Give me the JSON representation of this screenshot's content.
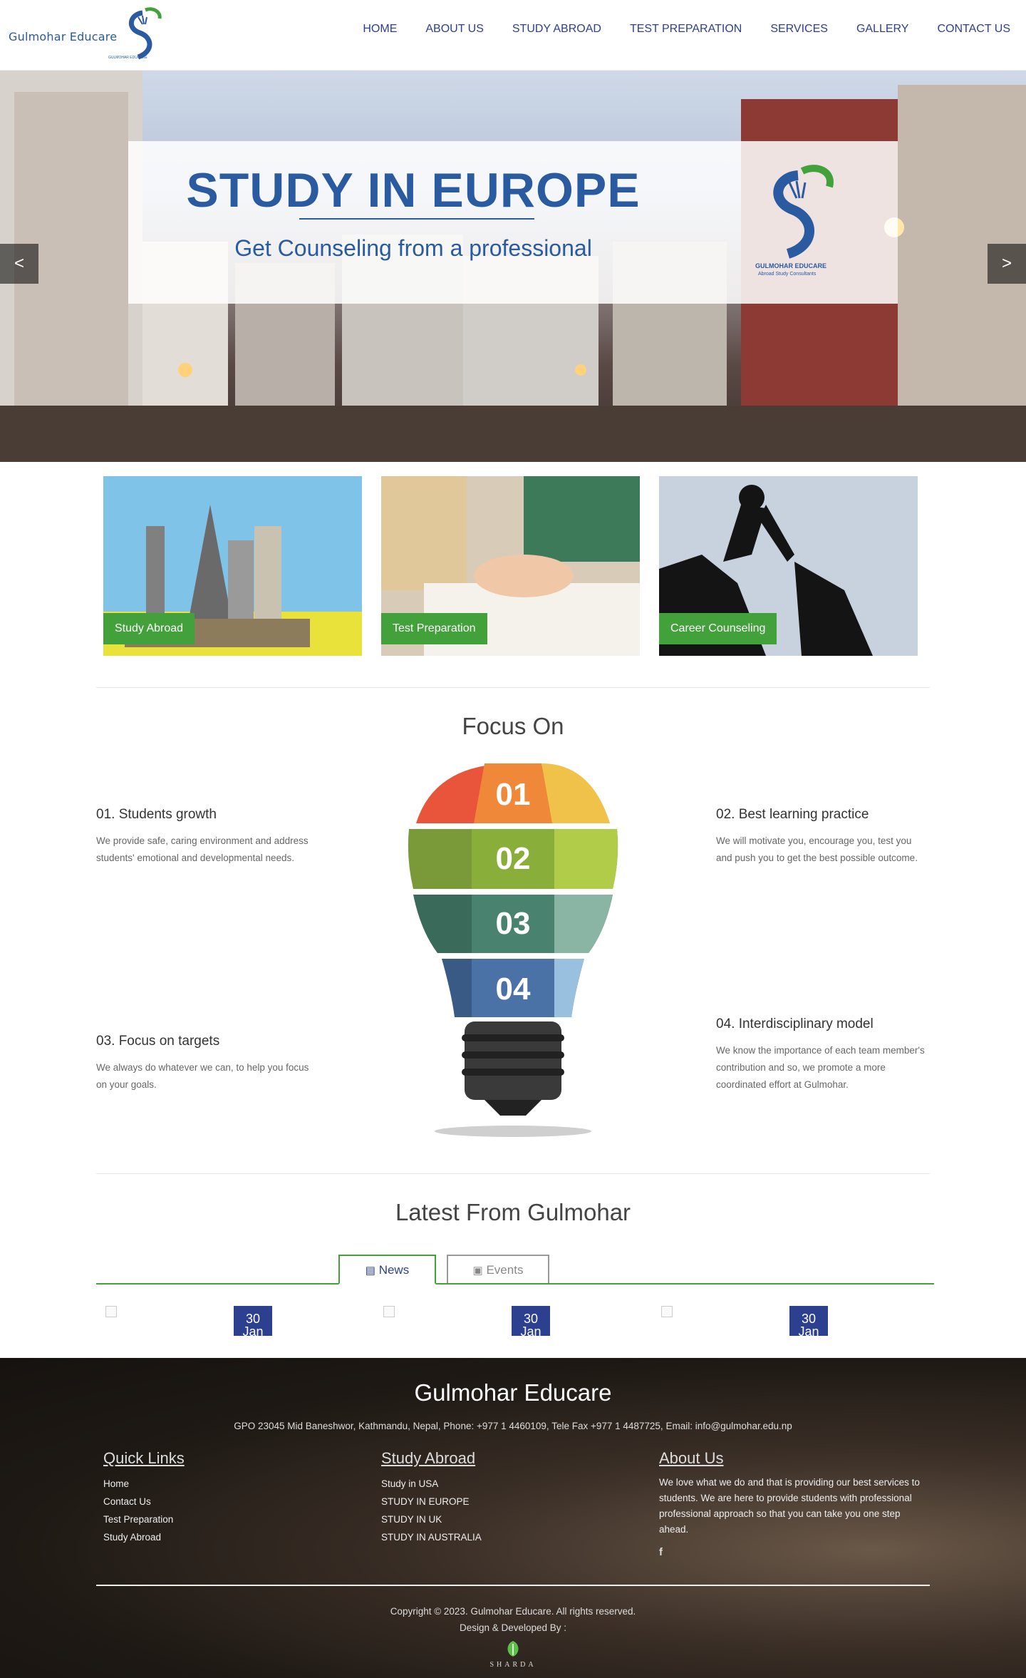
{
  "brand": {
    "name": "Gulmohar Educare",
    "sub": "GULMOHAR EDUCARE"
  },
  "nav": [
    "HOME",
    "ABOUT US",
    "STUDY ABROAD",
    "TEST PREPARATION",
    "SERVICES",
    "GALLERY",
    "CONTACT US"
  ],
  "hero": {
    "title": "STUDY IN EUROPE",
    "subtitle": "Get Counseling from a professional",
    "mark_label": "GULMOHAR EDUCARE",
    "mark_sub": "Abroad Study Consultants",
    "prev": "<",
    "next": ">"
  },
  "cards": [
    "Study Abroad",
    "Test Preparation",
    "Career Counseling"
  ],
  "focus": {
    "title": "Focus On",
    "items": [
      {
        "title": "01. Students growth",
        "text": "We provide safe, caring environment and address students' emotional and developmental needs."
      },
      {
        "title": "02. Best learning practice",
        "text": "We will motivate you, encourage you, test you and push you to get the best possible outcome."
      },
      {
        "title": "03. Focus on targets",
        "text": "We always do whatever we can, to help you focus on your goals."
      },
      {
        "title": "04. Interdisciplinary model",
        "text": "We know the importance of each team member's contribution and so, we promote a more coordinated effort at Gulmohar."
      }
    ],
    "bulb": [
      "01",
      "02",
      "03",
      "04"
    ]
  },
  "latest": {
    "title": "Latest From Gulmohar",
    "tabs": [
      "News",
      "Events"
    ],
    "items": [
      {
        "day": "30",
        "month": "Jan"
      },
      {
        "day": "30",
        "month": "Jan"
      },
      {
        "day": "30",
        "month": "Jan"
      }
    ]
  },
  "footer": {
    "title": "Gulmohar Educare",
    "address": "GPO 23045 Mid Baneshwor, Kathmandu, Nepal, Phone: +977 1 4460109, Tele Fax +977 1 4487725, Email: info@gulmohar.edu.np",
    "quick_links": {
      "heading": "Quick Links",
      "items": [
        "Home",
        "Contact Us",
        "Test Preparation",
        "Study Abroad"
      ]
    },
    "study_abroad": {
      "heading": "Study Abroad",
      "items": [
        "Study in USA",
        "STUDY IN EUROPE",
        "STUDY IN UK",
        "STUDY IN AUSTRALIA"
      ]
    },
    "about": {
      "heading": "About Us",
      "text": "We love what we do and that is providing our best services to students. We are here to provide students with professional professional approach so that you can take you one step ahead.",
      "social": "f"
    },
    "copyright": "Copyright © 2023. Gulmohar Educare. All rights reserved.",
    "design": "Design & Developed By :",
    "developer": "SHARDA"
  }
}
